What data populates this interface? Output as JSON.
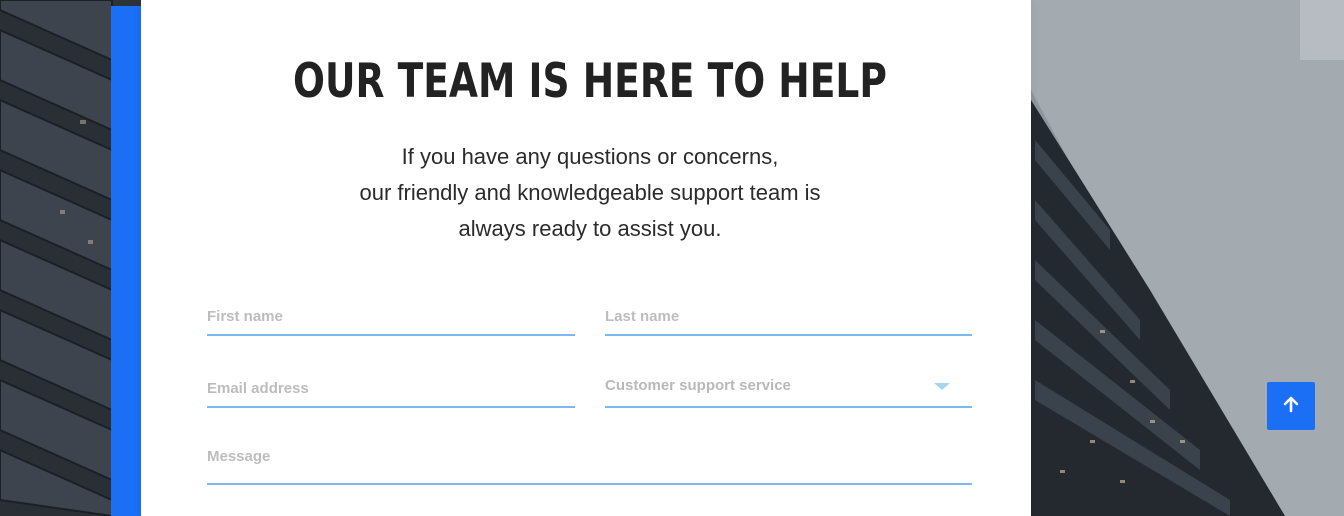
{
  "contact": {
    "title": "OUR TEAM IS HERE TO HELP",
    "subtitle_lines": [
      "If you have any questions or concerns,",
      "our friendly and knowledgeable support team is",
      "always ready to assist you."
    ]
  },
  "form": {
    "first_name_placeholder": "First name",
    "last_name_placeholder": "Last name",
    "email_placeholder": "Email address",
    "service_selected": "Customer support service",
    "message_placeholder": "Message"
  },
  "icons": {
    "select": "chevron-down-icon",
    "back_to_top": "arrow-up-icon"
  },
  "colors": {
    "accent": "#1a6ff5",
    "field_underline": "#7db8ef",
    "title": "#222222"
  }
}
